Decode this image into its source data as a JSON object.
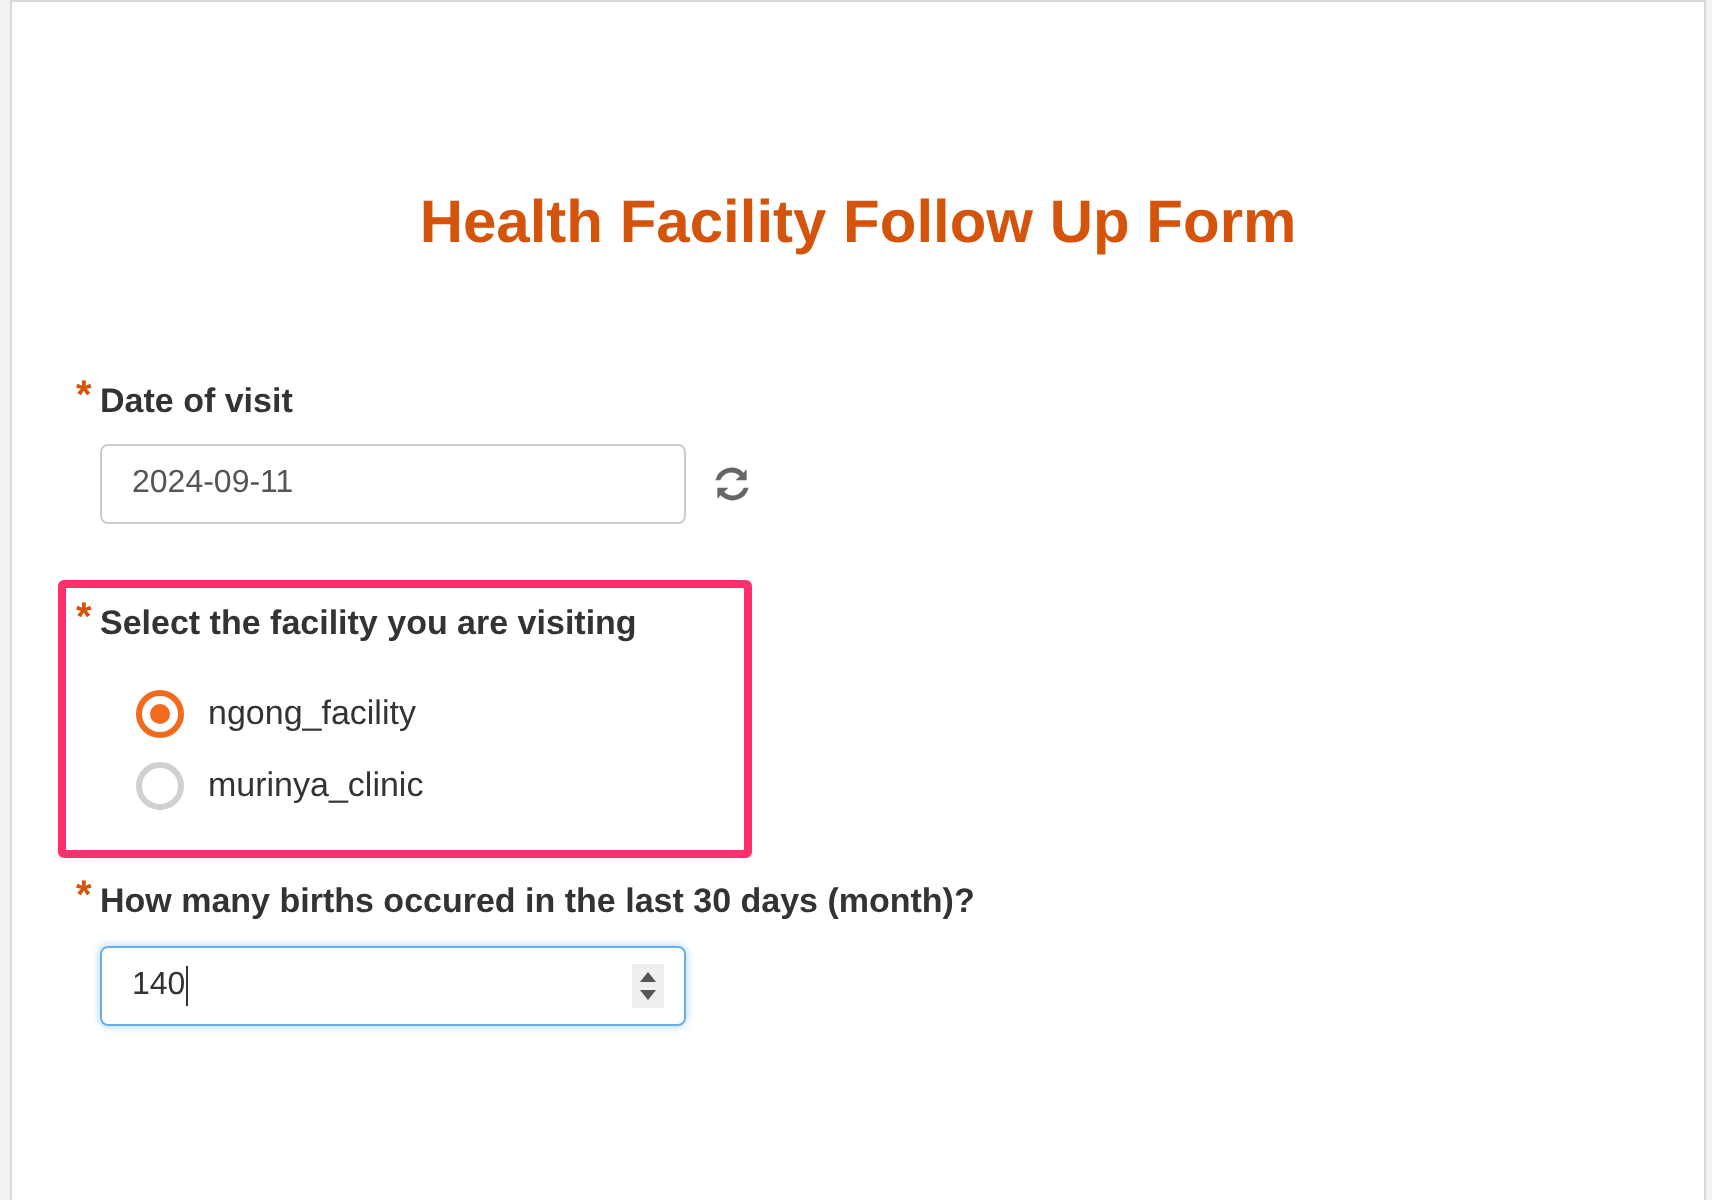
{
  "form": {
    "title": "Health Facility Follow Up Form"
  },
  "questions": [
    {
      "kind": "date",
      "marker": "*",
      "label": "Date of visit",
      "value": "2024-09-11",
      "highlighted": false
    },
    {
      "kind": "radio",
      "marker": "*",
      "label": "Select the facility you are visiting",
      "highlighted": true,
      "options": [
        {
          "label": "ngong_facility",
          "selected": true
        },
        {
          "label": "murinya_clinic",
          "selected": false
        }
      ]
    },
    {
      "kind": "number",
      "marker": "*",
      "label": "How many births occured in the last 30 days (month)?",
      "value": "140",
      "focused": true,
      "highlighted": false
    }
  ]
}
